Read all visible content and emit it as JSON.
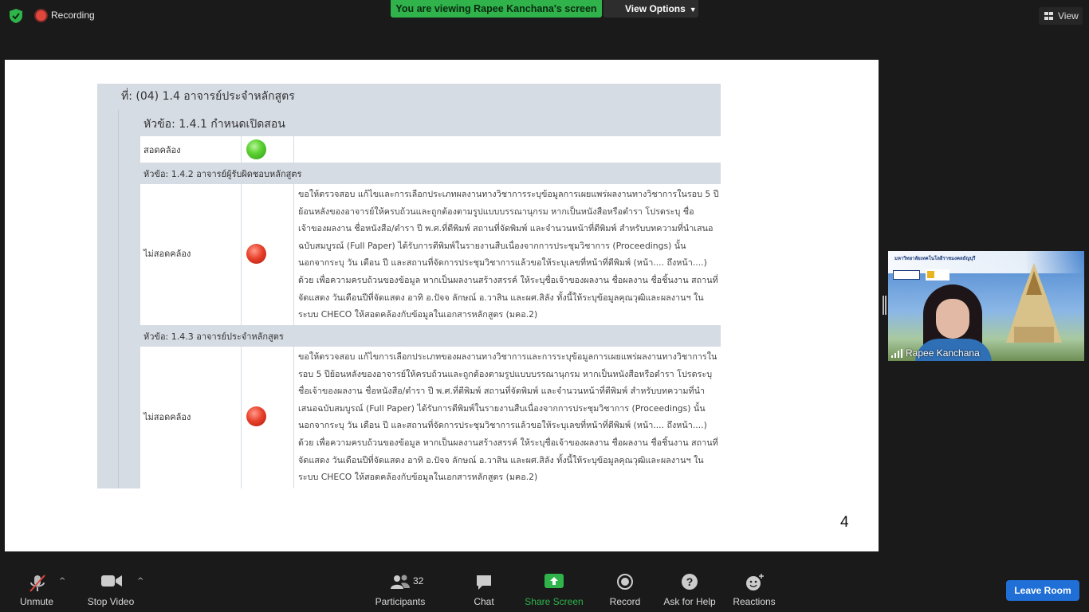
{
  "top_bar": {
    "recording_label": "Recording",
    "viewing_banner": "You are viewing Rapee Kanchana's screen",
    "view_options_label": "View Options",
    "view_button_label": "View"
  },
  "shared_document": {
    "title_row": "ที่: (04) 1.4 อาจารย์ประจำหลักสูตร",
    "sections": [
      {
        "topic": "หัวข้อ: 1.4.1 กำหนดเปิดสอน",
        "status": "สอดคล้อง",
        "light": "green",
        "detail": ""
      },
      {
        "topic": "หัวข้อ: 1.4.2 อาจารย์ผู้รับผิดชอบหลักสูตร",
        "status": "ไม่สอดคล้อง",
        "light": "red",
        "detail": "ขอให้ตรวจสอบ แก้ไขและการเลือกประเภทผลงานทางวิชาการระบุข้อมูลการเผยแพร่ผลงานทางวิชาการในรอบ 5 ปี ย้อนหลังของอาจารย์ให้ครบถ้วนและถูกต้องตามรูปแบบบรรณานุกรม หากเป็นหนังสือหรือตำรา โปรดระบุ ชื่อเจ้าของผลงาน ชื่อหนังสือ/ตำรา ปี พ.ศ.ที่ตีพิมพ์ สถานที่จัดพิมพ์ และจำนวนหน้าที่ตีพิมพ์ สำหรับบทความที่นำเสนอฉบับสมบูรณ์ (Full Paper) ได้รับการตีพิมพ์ในรายงานสืบเนื่องจากการประชุมวิชาการ (Proceedings) นั้น นอกจากระบุ วัน เดือน ปี และสถานที่จัดการประชุมวิชาการแล้วขอให้ระบุเลขที่หน้าที่ตีพิมพ์ (หน้า.... ถึงหน้า....) ด้วย เพื่อความครบถ้วนของข้อมูล หากเป็นผลงานสร้างสรรค์ ให้ระบุชื่อเจ้าของผลงาน ชื่อผลงาน ชื่อชิ้นงาน สถานที่จัดแสดง วันเดือนปีที่จัดแสดง อาทิ อ.ปัจจ ลักษณ์ อ.วาสิน และผศ.สิลัง ทั้งนี้ให้ระบุข้อมูลคุณวุฒิและผลงานฯ ในระบบ CHECO ให้สอดคล้องกับข้อมูลในเอกสารหลักสูตร (มคอ.2)"
      },
      {
        "topic": "หัวข้อ: 1.4.3 อาจารย์ประจำหลักสูตร",
        "status": "ไม่สอดคล้อง",
        "light": "red",
        "detail": "ขอให้ตรวจสอบ แก้ไขการเลือกประเภทของผลงานทางวิชาการและการระบุข้อมูลการเผยแพร่ผลงานทางวิชาการในรอบ 5 ปีย้อนหลังของอาจารย์ให้ครบถ้วนและถูกต้องตามรูปแบบบรรณานุกรม หากเป็นหนังสือหรือตำรา โปรดระบุ ชื่อเจ้าของผลงาน ชื่อหนังสือ/ตำรา ปี พ.ศ.ที่ตีพิมพ์ สถานที่จัดพิมพ์ และจำนวนหน้าที่ตีพิมพ์ สำหรับบทความที่นำเสนอฉบับสมบูรณ์ (Full Paper) ได้รับการตีพิมพ์ในรายงานสืบเนื่องจากการประชุมวิชาการ (Proceedings) นั้น นอกจากระบุ วัน เดือน ปี และสถานที่จัดการประชุมวิชาการแล้วขอให้ระบุเลขที่หน้าที่ตีพิมพ์ (หน้า.... ถึงหน้า....) ด้วย เพื่อความครบถ้วนของข้อมูล หากเป็นผลงานสร้างสรรค์ ให้ระบุชื่อเจ้าของผลงาน ชื่อผลงาน ชื่อชิ้นงาน สถานที่จัดแสดง วันเดือนปีที่จัดแสดง อาทิ อ.ปัจจ ลักษณ์ อ.วาสิน และผศ.สิลัง ทั้งนี้ให้ระบุข้อมูลคุณวุฒิและผลงานฯ ในระบบ CHECO ให้สอดคล้องกับข้อมูลในเอกสารหลักสูตร (มคอ.2)"
      }
    ],
    "page_number": "4"
  },
  "video_tile": {
    "participant_name": "Rapee Kanchana",
    "background_caption": "มหาวิทยาลัยเทคโนโลยีราชมงคลธัญบุรี"
  },
  "toolbar": {
    "unmute_label": "Unmute",
    "stop_video_label": "Stop Video",
    "participants_label": "Participants",
    "participants_count": "32",
    "chat_label": "Chat",
    "share_screen_label": "Share Screen",
    "record_label": "Record",
    "help_label": "Ask for Help",
    "reactions_label": "Reactions",
    "leave_label": "Leave Room"
  },
  "colors": {
    "share_green": "#2fb34a",
    "leave_blue": "#1f6fd6",
    "recording_red": "#e0463c",
    "table_header": "#d6dce4"
  },
  "icons": [
    "shield-check-icon",
    "recording-icon",
    "chevron-down-icon",
    "grid-icon",
    "signal-bars-icon",
    "microphone-muted-icon",
    "video-camera-icon",
    "participants-icon",
    "chat-icon",
    "share-screen-icon",
    "record-icon",
    "help-icon",
    "reactions-icon"
  ]
}
